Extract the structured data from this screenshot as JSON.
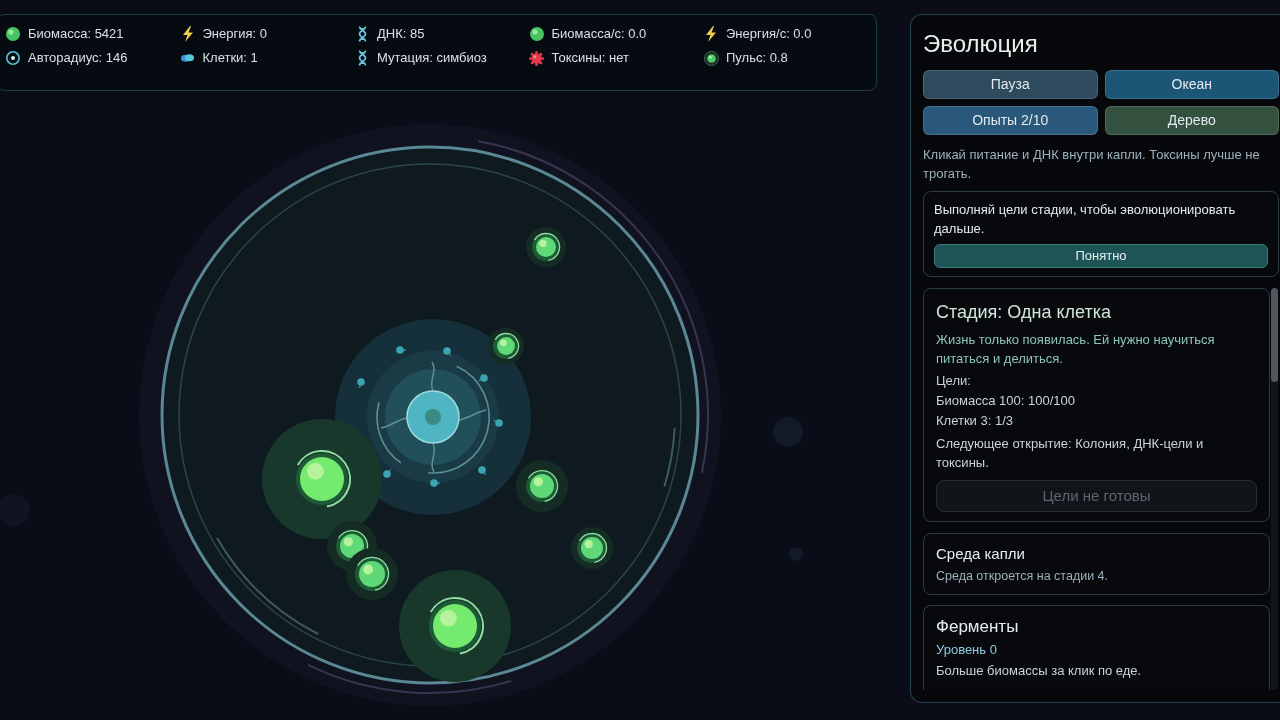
{
  "stats": [
    {
      "kind": "biomass",
      "text": "Биомасса: 5421"
    },
    {
      "kind": "energy",
      "text": "Энергия: 0"
    },
    {
      "kind": "dna",
      "text": "ДНК: 85"
    },
    {
      "kind": "biomass",
      "text": "Биомасса/с: 0.0"
    },
    {
      "kind": "energy",
      "text": "Энергия/с: 0.0"
    },
    {
      "kind": "radius",
      "text": "Авторадиус: 146"
    },
    {
      "kind": "cells",
      "text": "Клетки: 1"
    },
    {
      "kind": "dna",
      "text": "Мутация: симбиоз"
    },
    {
      "kind": "toxin",
      "text": "Токсины: нет"
    },
    {
      "kind": "pulse",
      "text": "Пульс: 0.8"
    }
  ],
  "panel": {
    "title": "Эволюция",
    "buttons": [
      {
        "label": "Пауза",
        "color": "#2e4a5d"
      },
      {
        "label": "Океан",
        "color": "#1b5677"
      },
      {
        "label": "Опыты 2/10",
        "color": "#29587b"
      },
      {
        "label": "Дерево",
        "color": "#34503f"
      }
    ],
    "hint": "Кликай питание и ДНК внутри капли. Токсины лучше не трогать.",
    "notice": {
      "text": "Выполняй цели стадии, чтобы эволюционировать дальше.",
      "button": "Понятно"
    },
    "cards": [
      {
        "kind": "stage",
        "title": "Стадия: Одна клетка",
        "description": "Жизнь только появилась. Ей нужно научиться питаться и делиться.",
        "goals_label": "Цели:",
        "goals": [
          "Биомасса 100: 100/100",
          "Клетки 3: 1/3"
        ],
        "next": "Следующее открытие: Колония, ДНК-цели и токсины.",
        "action": {
          "label": "Цели не готовы",
          "disabled": true
        }
      },
      {
        "kind": "locked",
        "title": "Среда капли",
        "text": "Среда откроется на стадии 4."
      },
      {
        "kind": "upgrade",
        "title": "Ферменты",
        "level": "Уровень 0",
        "text": "Больше биомассы за клик по еде."
      }
    ]
  }
}
